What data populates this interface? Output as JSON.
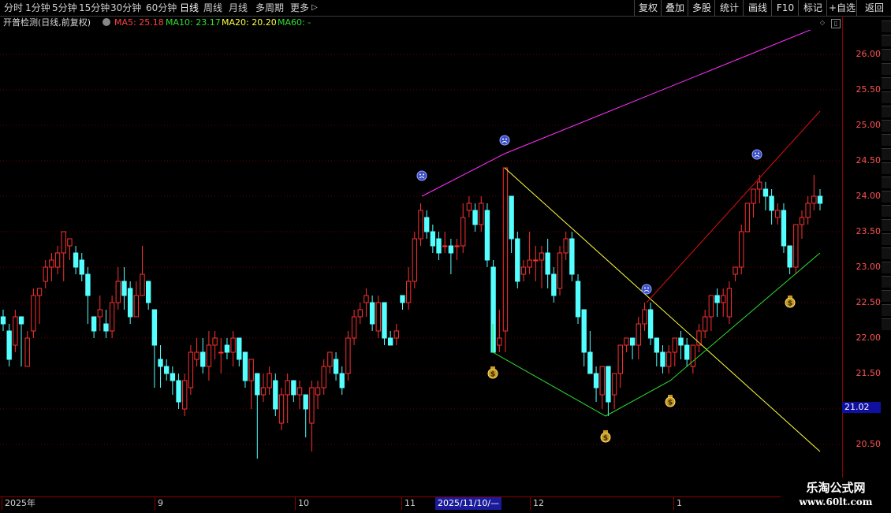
{
  "periods": [
    "分时",
    "1分钟",
    "5分钟",
    "15分钟",
    "30分钟",
    "60分钟",
    "日线",
    "周线",
    "月线",
    "多周期",
    "更多"
  ],
  "active_period": "日线",
  "more_arrow": "▷",
  "toolbar": [
    "复权",
    "叠加",
    "多股",
    "统计",
    "画线",
    "F10",
    "标记",
    "+自选",
    "返回"
  ],
  "info": {
    "title": "开普检测(日线,前复权)",
    "ma5": "MA5: 25.18",
    "ma10": "MA10: 23.17",
    "ma20": "MA20: 20.20",
    "ma60": "MA60: -"
  },
  "colors": {
    "up": "#ff3030",
    "down": "#54ffff",
    "ma_purple": "#ff30ff",
    "ma_red": "#e01010",
    "ma_yellow": "#ffff40",
    "ma_green": "#30e030",
    "grid": "#6a0000"
  },
  "y_axis": {
    "ticks": [
      "26.00",
      "25.50",
      "25.00",
      "24.50",
      "24.00",
      "23.50",
      "23.00",
      "22.50",
      "22.00",
      "21.50",
      "21.00",
      "20.50"
    ],
    "min": 20.0,
    "max": 26.6
  },
  "current_price": "21.02",
  "x_axis": {
    "labels": [
      "2025年",
      "9",
      "10",
      "11",
      "12",
      "1"
    ],
    "selected": "2025/11/10/—"
  },
  "watermark": {
    "line1": "乐淘公式网",
    "line2": "www.60lt.com"
  },
  "chart_data": {
    "type": "candlestick",
    "candles": [
      [
        22.3,
        22.2,
        22.4,
        22.1
      ],
      [
        22.1,
        21.7,
        22.2,
        21.6
      ],
      [
        21.9,
        22.3,
        22.4,
        21.8
      ],
      [
        22.3,
        22.2,
        22.3,
        21.6
      ],
      [
        21.6,
        22.0,
        22.1,
        21.6
      ],
      [
        22.1,
        22.6,
        22.7,
        22.0
      ],
      [
        22.6,
        22.7,
        22.7,
        22.2
      ],
      [
        22.8,
        23.0,
        23.1,
        22.7
      ],
      [
        23.0,
        23.1,
        23.2,
        22.8
      ],
      [
        23.0,
        23.2,
        23.3,
        22.9
      ],
      [
        23.2,
        23.5,
        23.5,
        22.8
      ],
      [
        23.3,
        23.4,
        23.4,
        23.1
      ],
      [
        23.2,
        23.0,
        23.3,
        22.9
      ],
      [
        23.1,
        22.9,
        23.2,
        22.8
      ],
      [
        22.9,
        22.6,
        23.0,
        22.2
      ],
      [
        22.3,
        22.1,
        22.3,
        22.0
      ],
      [
        22.3,
        22.4,
        22.6,
        22.1
      ],
      [
        22.2,
        22.1,
        22.4,
        22.0
      ],
      [
        22.1,
        22.5,
        22.6,
        22.0
      ],
      [
        22.5,
        22.8,
        23.0,
        22.4
      ],
      [
        22.8,
        22.6,
        23.0,
        22.4
      ],
      [
        22.7,
        22.3,
        22.8,
        22.2
      ],
      [
        22.3,
        22.6,
        22.8,
        22.3
      ],
      [
        22.6,
        22.9,
        23.3,
        22.6
      ],
      [
        22.8,
        22.5,
        22.8,
        22.4
      ],
      [
        22.4,
        21.9,
        22.4,
        21.3
      ],
      [
        21.7,
        21.6,
        21.9,
        21.3
      ],
      [
        21.6,
        21.5,
        21.7,
        21.4
      ],
      [
        21.5,
        21.4,
        21.6,
        21.2
      ],
      [
        21.4,
        21.1,
        21.5,
        21.0
      ],
      [
        21.0,
        21.4,
        21.5,
        20.9
      ],
      [
        21.3,
        21.8,
        21.9,
        21.2
      ],
      [
        21.7,
        21.8,
        22.0,
        21.6
      ],
      [
        21.8,
        21.6,
        22.0,
        21.5
      ],
      [
        21.6,
        21.9,
        22.1,
        21.4
      ],
      [
        21.9,
        22.0,
        22.1,
        21.7
      ],
      [
        21.8,
        21.8,
        22.0,
        21.5
      ],
      [
        21.9,
        21.8,
        22.0,
        21.7
      ],
      [
        21.8,
        22.0,
        22.1,
        21.6
      ],
      [
        22.0,
        21.7,
        22.0,
        21.6
      ],
      [
        21.8,
        21.4,
        21.8,
        21.3
      ],
      [
        21.4,
        21.7,
        21.7,
        21.0
      ],
      [
        21.5,
        21.2,
        21.5,
        20.3
      ],
      [
        21.2,
        21.3,
        21.5,
        21.1
      ],
      [
        21.3,
        21.5,
        21.6,
        21.2
      ],
      [
        21.4,
        21.0,
        21.5,
        20.9
      ],
      [
        20.8,
        21.2,
        21.3,
        20.7
      ],
      [
        21.2,
        21.4,
        21.5,
        20.8
      ],
      [
        21.4,
        21.2,
        21.4,
        21.1
      ],
      [
        21.2,
        21.3,
        21.4,
        21.0
      ],
      [
        21.2,
        21.0,
        21.2,
        20.6
      ],
      [
        20.8,
        21.3,
        21.4,
        20.4
      ],
      [
        21.2,
        21.3,
        21.4,
        21.0
      ],
      [
        21.3,
        21.6,
        21.7,
        21.2
      ],
      [
        21.6,
        21.8,
        21.8,
        21.5
      ],
      [
        21.7,
        21.5,
        21.8,
        21.4
      ],
      [
        21.5,
        21.3,
        21.6,
        21.2
      ],
      [
        21.5,
        22.0,
        22.1,
        21.4
      ],
      [
        22.0,
        22.3,
        22.4,
        21.9
      ],
      [
        22.3,
        22.4,
        22.5,
        22.2
      ],
      [
        22.5,
        22.6,
        22.7,
        22.3
      ],
      [
        22.5,
        22.2,
        22.6,
        22.1
      ],
      [
        22.1,
        22.5,
        22.6,
        22.0
      ],
      [
        22.5,
        22.0,
        22.5,
        21.9
      ],
      [
        22.0,
        21.9,
        22.1,
        21.9
      ],
      [
        22.0,
        22.1,
        22.2,
        21.9
      ],
      [
        22.6,
        22.5,
        22.6,
        22.4
      ],
      [
        22.5,
        22.8,
        23.0,
        22.4
      ],
      [
        22.8,
        23.4,
        23.5,
        22.7
      ],
      [
        23.4,
        23.8,
        23.9,
        23.3
      ],
      [
        23.7,
        23.5,
        23.8,
        23.4
      ],
      [
        23.5,
        23.3,
        23.6,
        23.2
      ],
      [
        23.4,
        23.2,
        23.5,
        23.1
      ],
      [
        23.3,
        23.3,
        23.5,
        23.2
      ],
      [
        23.3,
        23.2,
        23.4,
        22.9
      ],
      [
        23.3,
        23.3,
        23.4,
        23.1
      ],
      [
        23.3,
        23.7,
        23.9,
        23.2
      ],
      [
        23.8,
        23.9,
        24.0,
        23.7
      ],
      [
        23.8,
        23.6,
        23.9,
        23.5
      ],
      [
        23.6,
        23.9,
        24.0,
        23.5
      ],
      [
        23.8,
        23.1,
        23.9,
        23.0
      ],
      [
        23.0,
        21.8,
        23.1,
        21.8
      ],
      [
        21.9,
        22.0,
        22.4,
        21.8
      ],
      [
        22.1,
        24.4,
        24.4,
        21.8
      ],
      [
        24.0,
        23.4,
        24.0,
        23.2
      ],
      [
        23.4,
        22.8,
        23.5,
        22.7
      ],
      [
        22.9,
        23.0,
        23.1,
        22.8
      ],
      [
        23.0,
        23.1,
        23.5,
        22.9
      ],
      [
        23.1,
        23.1,
        23.3,
        22.8
      ],
      [
        23.1,
        23.2,
        23.3,
        22.7
      ],
      [
        23.2,
        22.9,
        23.4,
        22.7
      ],
      [
        22.9,
        22.6,
        23.0,
        22.5
      ],
      [
        22.7,
        23.2,
        23.3,
        22.6
      ],
      [
        23.2,
        23.4,
        23.5,
        23.1
      ],
      [
        23.4,
        22.9,
        23.5,
        22.8
      ],
      [
        22.8,
        22.3,
        22.9,
        22.2
      ],
      [
        22.4,
        21.8,
        22.4,
        21.6
      ],
      [
        21.8,
        21.5,
        22.1,
        21.5
      ],
      [
        21.5,
        21.3,
        21.6,
        21.1
      ],
      [
        21.2,
        21.6,
        21.6,
        21.0
      ],
      [
        21.6,
        21.1,
        21.6,
        20.9
      ],
      [
        21.2,
        21.5,
        21.5,
        21.0
      ],
      [
        21.5,
        21.9,
        21.9,
        21.3
      ],
      [
        21.9,
        22.0,
        22.0,
        21.8
      ],
      [
        22.0,
        21.9,
        22.0,
        21.7
      ],
      [
        21.9,
        22.2,
        22.3,
        21.7
      ],
      [
        22.2,
        22.4,
        22.5,
        22.1
      ],
      [
        22.4,
        22.0,
        22.5,
        21.9
      ],
      [
        22.0,
        21.8,
        22.0,
        21.6
      ],
      [
        21.8,
        21.6,
        21.9,
        21.5
      ],
      [
        21.6,
        21.8,
        21.9,
        21.5
      ],
      [
        21.8,
        22.0,
        22.0,
        21.6
      ],
      [
        22.0,
        21.9,
        22.1,
        21.7
      ],
      [
        21.9,
        21.7,
        22.0,
        21.6
      ],
      [
        21.6,
        21.9,
        21.9,
        21.5
      ],
      [
        21.9,
        22.1,
        22.2,
        21.8
      ],
      [
        22.1,
        22.3,
        22.4,
        22.0
      ],
      [
        22.3,
        22.6,
        22.6,
        22.1
      ],
      [
        22.6,
        22.5,
        22.7,
        22.3
      ],
      [
        22.5,
        22.6,
        22.7,
        22.3
      ],
      [
        22.3,
        22.7,
        22.8,
        22.2
      ],
      [
        22.9,
        23.0,
        23.0,
        22.8
      ],
      [
        23.0,
        23.5,
        23.6,
        22.9
      ],
      [
        23.5,
        23.9,
        23.9,
        23.5
      ],
      [
        23.9,
        24.1,
        24.1,
        23.7
      ],
      [
        24.1,
        24.2,
        24.3,
        23.9
      ],
      [
        24.1,
        24.0,
        24.2,
        23.8
      ],
      [
        24.0,
        23.8,
        24.1,
        23.6
      ],
      [
        23.7,
        23.8,
        23.9,
        23.6
      ],
      [
        23.8,
        23.3,
        23.9,
        23.2
      ],
      [
        23.3,
        23.0,
        23.3,
        22.9
      ],
      [
        23.0,
        23.6,
        23.6,
        22.9
      ],
      [
        23.6,
        23.7,
        23.8,
        23.4
      ],
      [
        23.7,
        23.9,
        24.0,
        23.6
      ],
      [
        23.9,
        24.0,
        24.3,
        23.8
      ],
      [
        24.0,
        23.9,
        24.1,
        23.8
      ]
    ],
    "lines": [
      {
        "name": "upper_outer",
        "color": "#ff30ff",
        "points": [
          [
            535,
            24.0
          ],
          [
            640,
            24.6
          ],
          [
            1040,
            26.4
          ]
        ]
      },
      {
        "name": "left_down",
        "color": "#ffff40",
        "points": [
          [
            640,
            24.4
          ],
          [
            1040,
            20.4
          ]
        ]
      },
      {
        "name": "right_up",
        "color": "#e01010",
        "points": [
          [
            820,
            22.5
          ],
          [
            1040,
            25.2
          ]
        ]
      },
      {
        "name": "support",
        "color": "#30e030",
        "points": [
          [
            625,
            21.8
          ],
          [
            768,
            20.9
          ],
          [
            850,
            21.4
          ],
          [
            1040,
            23.2
          ]
        ]
      },
      {
        "name": "left_stem",
        "color": "#30e030",
        "points": [
          [
            625,
            21.8
          ],
          [
            625,
            22.2
          ]
        ]
      }
    ],
    "sad_markers": [
      [
        535,
        24.2
      ],
      [
        640,
        24.7
      ],
      [
        820,
        22.6
      ],
      [
        960,
        24.5
      ]
    ],
    "money_markers": [
      [
        625,
        21.5
      ],
      [
        768,
        20.6
      ],
      [
        850,
        21.1
      ],
      [
        1002,
        22.5
      ]
    ]
  }
}
